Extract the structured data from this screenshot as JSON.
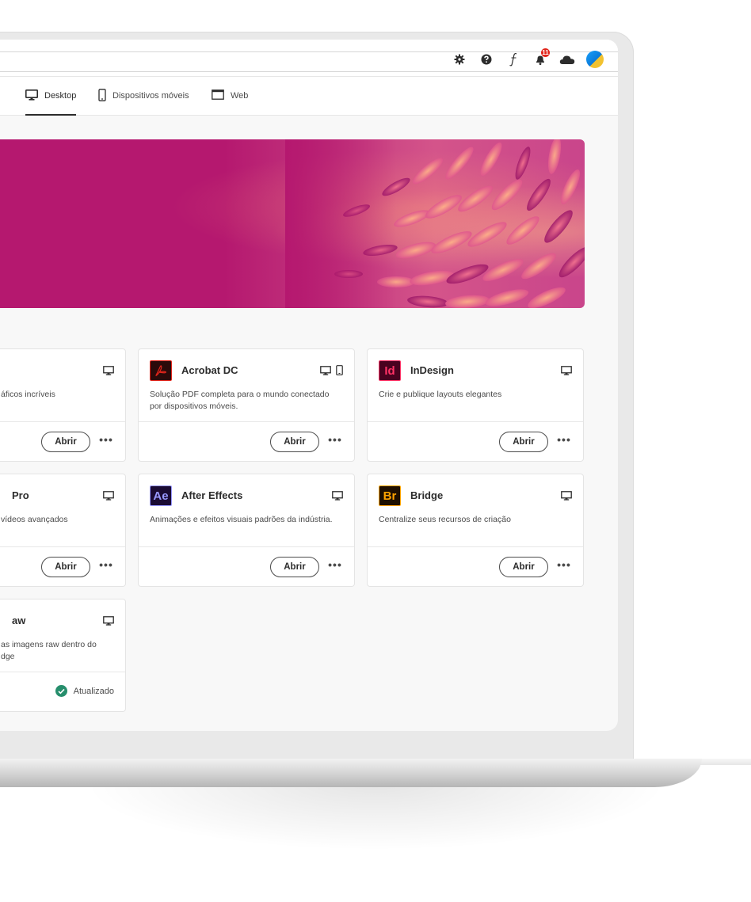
{
  "tabs": [
    {
      "label": "Desktop",
      "icon": "desktop-icon",
      "active": true
    },
    {
      "label": "Dispositivos móveis",
      "icon": "mobile-device-icon"
    },
    {
      "label": "Web",
      "icon": "browser-window-icon"
    }
  ],
  "topbar": {
    "icons": [
      "gear-icon",
      "help-icon",
      "fonts-icon",
      "notifications-icon",
      "cloud-icon",
      "avatar"
    ],
    "notification_count": "11"
  },
  "cards": [
    {
      "name": "",
      "desc": "áficos incríveis",
      "button": "Abrir",
      "more": "•••",
      "platforms": [
        "desktop"
      ]
    },
    {
      "name": "Acrobat DC",
      "logo_text": "",
      "logo_icon": "acrobat-icon",
      "desc": "Solução PDF completa para o mundo conectado por dispositivos móveis.",
      "button": "Abrir",
      "more": "•••",
      "platforms": [
        "desktop",
        "mobile"
      ]
    },
    {
      "name": "InDesign",
      "logo_text": "Id",
      "desc": "Crie e publique layouts elegantes",
      "button": "Abrir",
      "more": "•••",
      "platforms": [
        "desktop"
      ]
    },
    {
      "name": "Pro",
      "desc": "vídeos avançados",
      "button": "Abrir",
      "more": "•••",
      "platforms": [
        "desktop"
      ]
    },
    {
      "name": "After Effects",
      "logo_text": "Ae",
      "desc": "Animações e efeitos visuais padrões da indústria.",
      "button": "Abrir",
      "more": "•••",
      "platforms": [
        "desktop"
      ]
    },
    {
      "name": "Bridge",
      "logo_text": "Br",
      "desc": "Centralize seus recursos de criação",
      "button": "Abrir",
      "more": "•••",
      "platforms": [
        "desktop"
      ]
    },
    {
      "name": "aw",
      "desc": "as imagens raw dentro do\ndge",
      "status": "Atualizado",
      "platforms": [
        "desktop"
      ]
    }
  ],
  "colors": {
    "banner_magenta": "#b5186f",
    "acrobat_bg": "#2b0a0a",
    "acrobat_border": "#e1251b",
    "indesign_bg": "#49021f",
    "indesign_accent": "#ff3366",
    "aftereffects_bg": "#1a0b33",
    "aftereffects_accent": "#9999ff",
    "bridge_bg": "#1e0f00",
    "bridge_accent": "#ffa300",
    "status_green": "#268e6c"
  }
}
